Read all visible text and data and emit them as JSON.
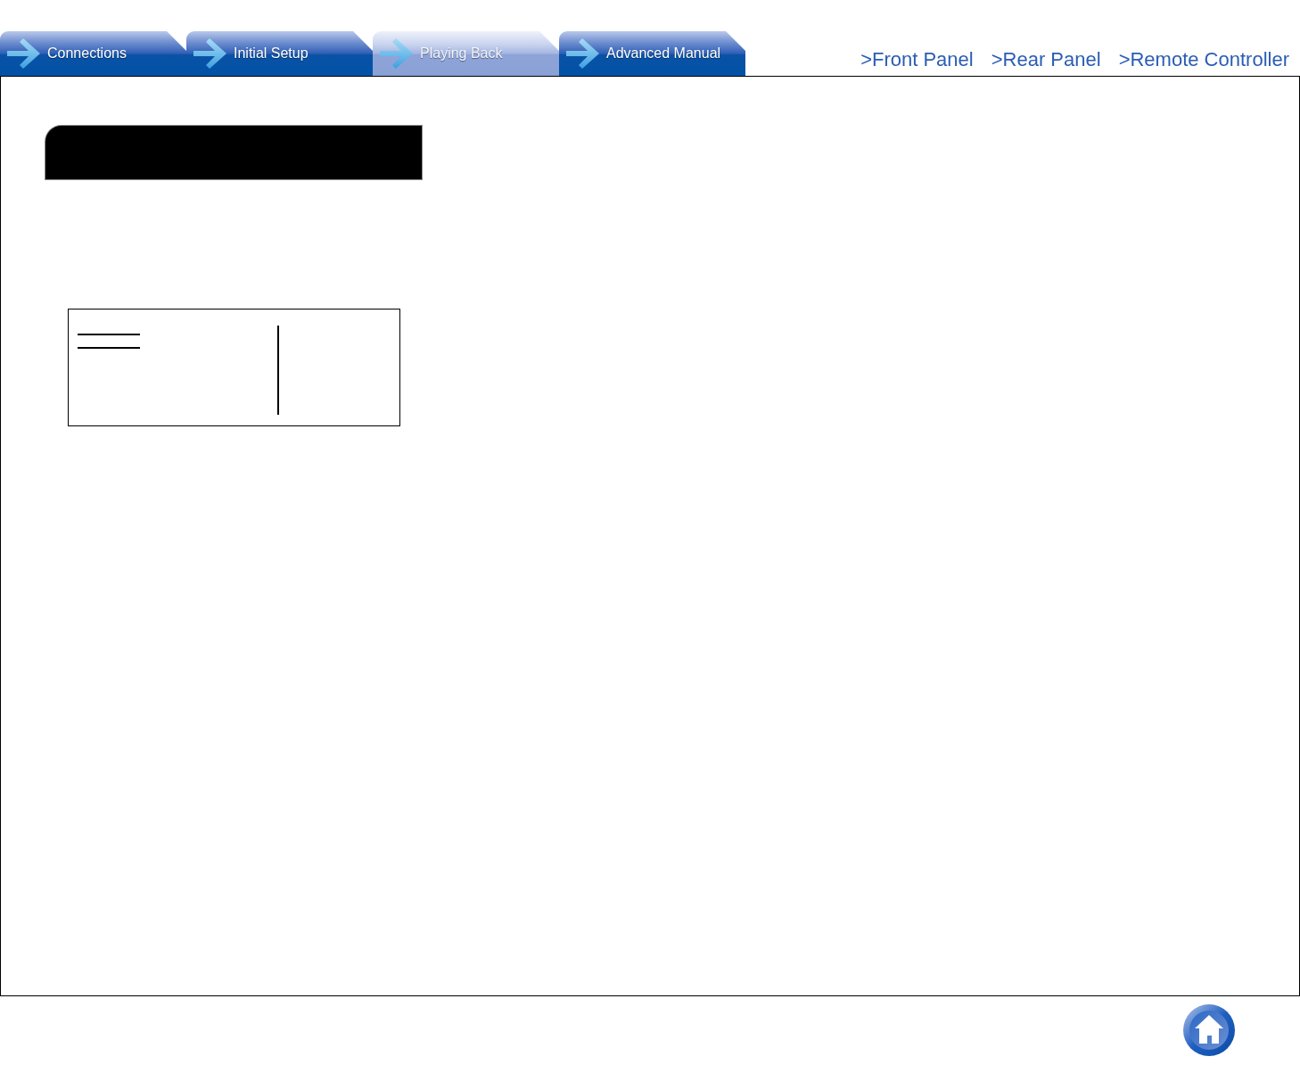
{
  "tabs": [
    {
      "label": "Connections",
      "selected": false
    },
    {
      "label": "Initial Setup",
      "selected": false
    },
    {
      "label": "Playing Back",
      "selected": true
    },
    {
      "label": "Advanced Manual",
      "selected": false
    }
  ],
  "nav_links": [
    {
      "label": ">Front Panel"
    },
    {
      "label": ">Rear Panel"
    },
    {
      "label": ">Remote Controller"
    }
  ]
}
